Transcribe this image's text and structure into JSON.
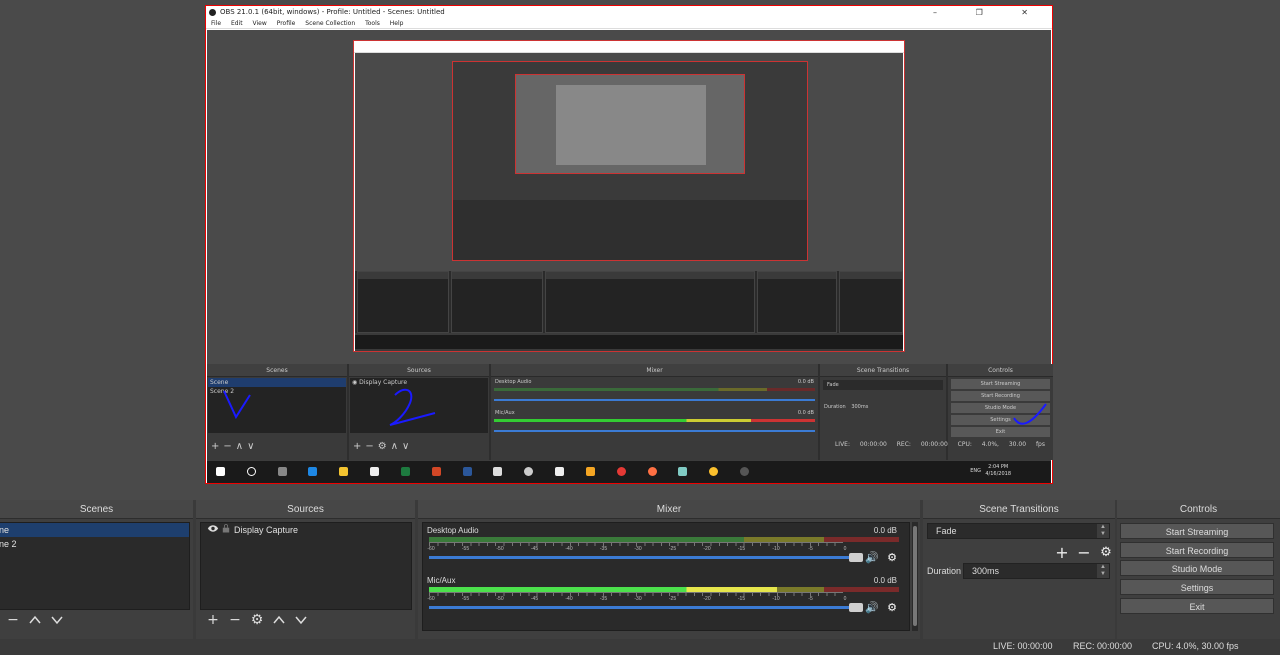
{
  "capture": {
    "window_title": "OBS 21.0.1 (64bit, windows) - Profile: Untitled - Scenes: Untitled",
    "menu": [
      "File",
      "Edit",
      "View",
      "Profile",
      "Scene Collection",
      "Tools",
      "Help"
    ],
    "window_buttons": "–  ❐  ✕",
    "scenes_header": "Scenes",
    "sources_header": "Sources",
    "mixer_header": "Mixer",
    "transitions_header": "Scene Transitions",
    "controls_header": "Controls",
    "scenes": [
      "Scene",
      "Scene 2"
    ],
    "source": "Display Capture",
    "ch1": "Desktop Audio",
    "ch2": "Mic/Aux",
    "db": "0.0 dB",
    "transition": "Fade",
    "duration_label": "Duration",
    "duration": "300ms",
    "buttons": [
      "Start Streaming",
      "Start Recording",
      "Studio Mode",
      "Settings",
      "Exit"
    ],
    "status": "LIVE: 00:00:00   REC: 00:00:00   CPU: 4.0%, 30.00 fps",
    "taskbar": {
      "lang": "ENG",
      "time": "2:04 PM",
      "date": "4/16/2018"
    }
  },
  "panels": {
    "scenes": "Scenes",
    "sources": "Sources",
    "mixer": "Mixer",
    "transitions": "Scene Transitions",
    "controls": "Controls"
  },
  "scenes": {
    "items": [
      "ne",
      "ne 2"
    ]
  },
  "sources": {
    "items": [
      "Display Capture"
    ]
  },
  "mixer": {
    "channels": [
      {
        "name": "Desktop Audio",
        "db": "0.0 dB",
        "level": 0
      },
      {
        "name": "Mic/Aux",
        "db": "0.0 dB",
        "level": 0.74
      }
    ],
    "tick_labels": [
      "-60",
      "-55",
      "-50",
      "-45",
      "-40",
      "-35",
      "-30",
      "-25",
      "-20",
      "-15",
      "-10",
      "-5",
      "0"
    ]
  },
  "transitions": {
    "selected": "Fade",
    "duration_label": "Duration",
    "duration_value": "300ms"
  },
  "controls": {
    "start_streaming": "Start Streaming",
    "start_recording": "Start Recording",
    "studio_mode": "Studio Mode",
    "settings": "Settings",
    "exit": "Exit"
  },
  "status": {
    "live": "LIVE: 00:00:00",
    "rec": "REC: 00:00:00",
    "cpu": "CPU: 4.0%, 30.00 fps"
  },
  "colors": {
    "accent_blue": "#3b7bd4",
    "selection": "#1e3f6e",
    "capture_border": "#e00000"
  },
  "icons": [
    "eye-icon",
    "lock-icon",
    "plus-icon",
    "minus-icon",
    "gear-icon",
    "up-arrow-icon",
    "down-arrow-icon",
    "speaker-icon"
  ]
}
